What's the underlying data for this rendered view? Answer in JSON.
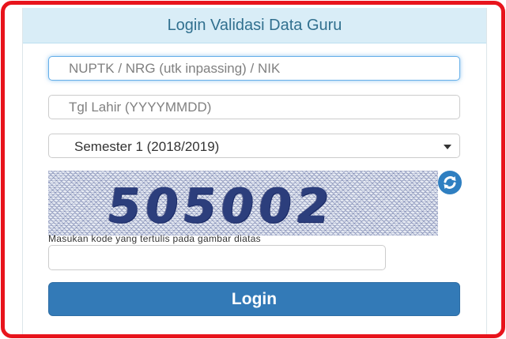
{
  "panel": {
    "title": "Login Validasi Data Guru"
  },
  "form": {
    "nuptk_placeholder": "NUPTK / NRG (utk inpassing) / NIK",
    "tgl_lahir_placeholder": "Tgl Lahir (YYYYMMDD)",
    "semester_selected": "Semester 1 (2018/2019)",
    "captcha_code": "505002",
    "captcha_instruction": "Masukan kode yang tertulis pada gambar diatas",
    "captcha_input_value": "",
    "login_label": "Login"
  },
  "colors": {
    "frame_border": "#e8141c",
    "header_bg": "#d9edf7",
    "header_text": "#31708f",
    "button_bg": "#337ab7",
    "focus_border": "#66afe9"
  },
  "icons": {
    "captcha_refresh": "refresh-icon",
    "select_caret": "caret-down-icon"
  }
}
